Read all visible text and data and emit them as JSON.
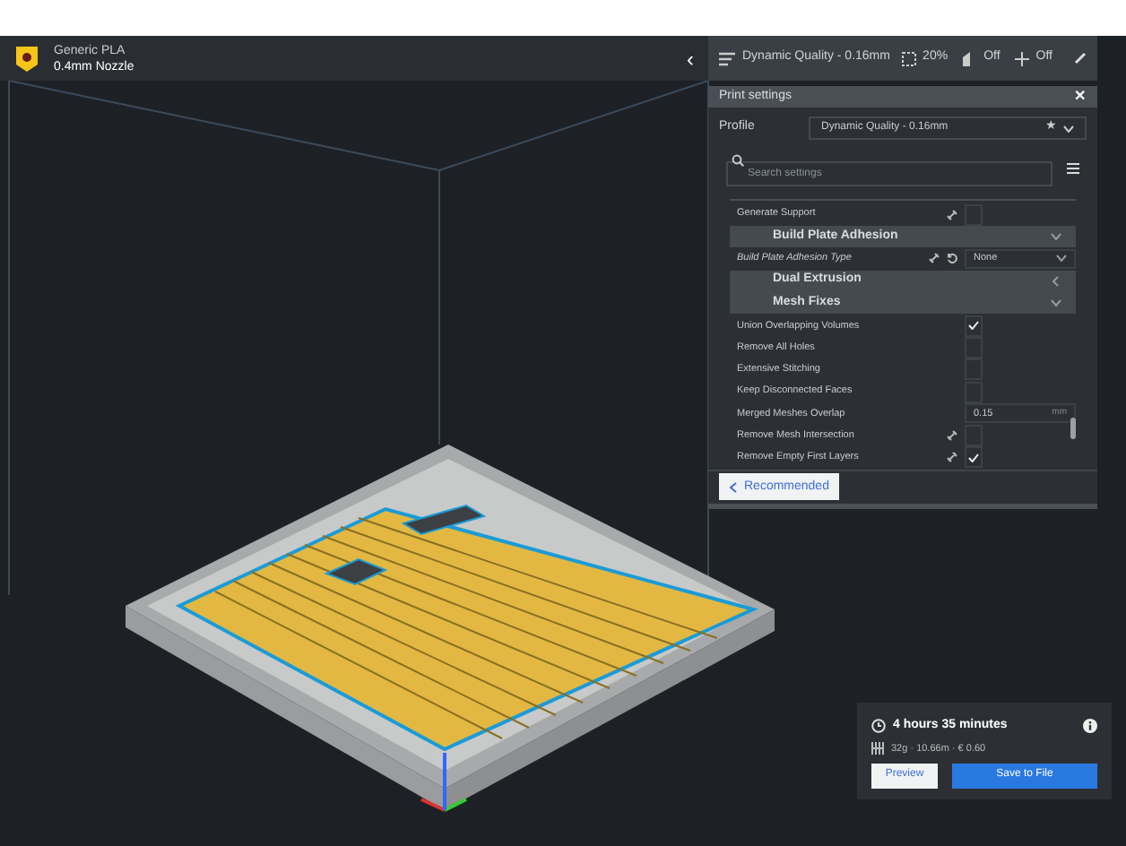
{
  "material": {
    "name": "Generic PLA",
    "nozzle": "0.4mm Nozzle"
  },
  "collapse_button": "‹",
  "print_toolbar": {
    "profile": "Dynamic Quality - 0.16mm",
    "infill": "20%",
    "support": "Off",
    "adhesion": "Off"
  },
  "print_settings": {
    "title": "Print settings",
    "close": "✕",
    "profile_label": "Profile",
    "profile_value": "Dynamic Quality - 0.16mm",
    "favorite_star": "★",
    "search_placeholder": "Search settings",
    "settings": [
      {
        "kind": "checkbox",
        "label": "Generate Support",
        "linked": true,
        "reset": false,
        "checked": false
      },
      {
        "kind": "category",
        "label": "Build Plate Adhesion",
        "expanded": true
      },
      {
        "kind": "dropdown",
        "label": "Build Plate Adhesion Type",
        "linked": true,
        "reset": true,
        "value": "None"
      },
      {
        "kind": "category",
        "label": "Dual Extrusion",
        "expanded": false
      },
      {
        "kind": "category",
        "label": "Mesh Fixes",
        "expanded": true
      },
      {
        "kind": "checkbox",
        "label": "Union Overlapping Volumes",
        "linked": false,
        "reset": false,
        "checked": true
      },
      {
        "kind": "checkbox",
        "label": "Remove All Holes",
        "linked": false,
        "reset": false,
        "checked": false
      },
      {
        "kind": "checkbox",
        "label": "Extensive Stitching",
        "linked": false,
        "reset": false,
        "checked": false
      },
      {
        "kind": "checkbox",
        "label": "Keep Disconnected Faces",
        "linked": false,
        "reset": false,
        "checked": false
      },
      {
        "kind": "number",
        "label": "Merged Meshes Overlap",
        "linked": false,
        "reset": false,
        "value": "0.15",
        "unit": "mm"
      },
      {
        "kind": "checkbox",
        "label": "Remove Mesh Intersection",
        "linked": true,
        "reset": false,
        "checked": false
      },
      {
        "kind": "checkbox",
        "label": "Remove Empty First Layers",
        "linked": true,
        "reset": false,
        "checked": true
      }
    ],
    "recommended_button": "Recommended"
  },
  "estimate": {
    "time": "4 hours 35 minutes",
    "material": "32g · 10.66m · € 0.60",
    "preview_button": "Preview",
    "save_button": "Save to File"
  }
}
